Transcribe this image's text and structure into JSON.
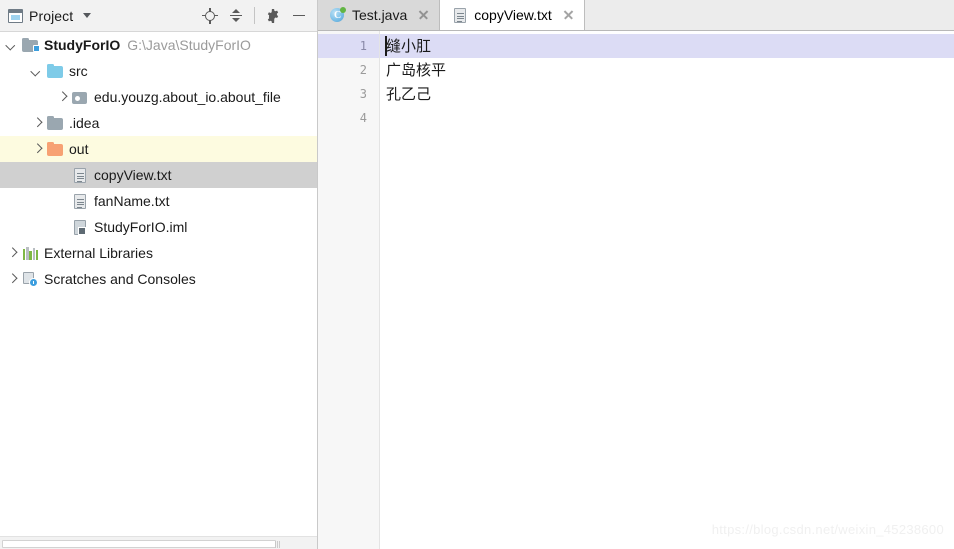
{
  "project_panel": {
    "title": "Project",
    "title_icon": "window-icon",
    "dropdown_icon": "chevron-down-icon",
    "actions": [
      {
        "name": "locate-icon",
        "tooltip": "Select Opened File"
      },
      {
        "name": "collapse-all-icon",
        "tooltip": "Collapse All"
      },
      {
        "name": "gear-icon",
        "tooltip": "Settings"
      },
      {
        "name": "minimize-icon",
        "tooltip": "Hide"
      }
    ],
    "tree": [
      {
        "label": "StudyForIO",
        "path": "G:\\Java\\StudyForIO",
        "icon": "module-folder-icon",
        "indent": 0,
        "arrow": "down",
        "bold": true,
        "state": "normal"
      },
      {
        "label": "src",
        "path": "",
        "icon": "source-folder-icon",
        "indent": 1,
        "arrow": "down",
        "bold": false,
        "state": "normal"
      },
      {
        "label": "edu.youzg.about_io.about_file",
        "path": "",
        "icon": "package-icon",
        "indent": 2,
        "arrow": "right",
        "bold": false,
        "state": "normal"
      },
      {
        "label": ".idea",
        "path": "",
        "icon": "folder-icon",
        "indent": 1,
        "arrow": "right",
        "bold": false,
        "state": "normal"
      },
      {
        "label": "out",
        "path": "",
        "icon": "excluded-folder-icon",
        "indent": 1,
        "arrow": "right",
        "bold": false,
        "state": "excluded"
      },
      {
        "label": "copyView.txt",
        "path": "",
        "icon": "text-file-icon",
        "indent": 2,
        "arrow": "none",
        "bold": false,
        "state": "selected"
      },
      {
        "label": "fanName.txt",
        "path": "",
        "icon": "text-file-icon",
        "indent": 2,
        "arrow": "none",
        "bold": false,
        "state": "normal"
      },
      {
        "label": "StudyForIO.iml",
        "path": "",
        "icon": "module-file-icon",
        "indent": 2,
        "arrow": "none",
        "bold": false,
        "state": "normal"
      },
      {
        "label": "External Libraries",
        "path": "",
        "icon": "libraries-icon",
        "indent": 0,
        "arrow": "right",
        "bold": false,
        "state": "normal"
      },
      {
        "label": "Scratches and Consoles",
        "path": "",
        "icon": "scratches-icon",
        "indent": 0,
        "arrow": "right",
        "bold": false,
        "state": "normal"
      }
    ]
  },
  "editor": {
    "tabs": [
      {
        "label": "Test.java",
        "icon": "java-class-icon",
        "active": false,
        "close_icon": "close-icon"
      },
      {
        "label": "copyView.txt",
        "icon": "text-file-icon",
        "active": true,
        "close_icon": "close-icon"
      }
    ],
    "gutter": [
      "1",
      "2",
      "3",
      "4"
    ],
    "lines": [
      {
        "number": "1",
        "text": "缝小肛",
        "current": true,
        "caret": true
      },
      {
        "number": "2",
        "text": "广岛核平",
        "current": false,
        "caret": false
      },
      {
        "number": "3",
        "text": "孔乙己",
        "current": false,
        "caret": false
      },
      {
        "number": "4",
        "text": "",
        "current": false,
        "caret": false
      }
    ]
  },
  "watermark": "https://blog.csdn.net/weixin_45238600",
  "colors": {
    "selection": "#d0d0d0",
    "excluded": "#fdfbe0",
    "caret_line": "#dcdcf5",
    "toolbar_bg": "#f2f2f2",
    "tab_inactive": "#d9d9d9",
    "accent_blue": "#3c9ede",
    "accent_green": "#62b543",
    "folder_orange": "#f7a173",
    "folder_blue": "#7ecbe8",
    "folder_gray": "#9aa7b0"
  }
}
